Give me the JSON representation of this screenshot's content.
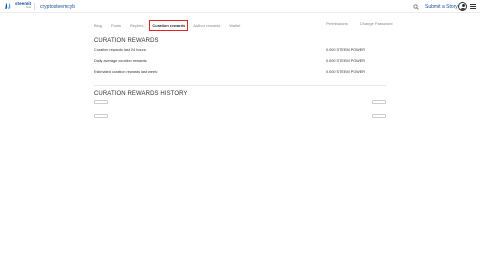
{
  "header": {
    "logo_text": "steemit",
    "logo_sub": "beta",
    "username": "cryptosteemcyb",
    "submit_story": "Submit a Story",
    "icons": {
      "logo": "steemit-logo-icon",
      "search": "search-icon",
      "avatar": "avatar-icon",
      "menu": "hamburger-menu-icon"
    }
  },
  "tabs": {
    "left": [
      "Blog",
      "Posts",
      "Replies",
      "Curation rewards",
      "Author rewards",
      "Wallet"
    ],
    "active": "Curation rewards",
    "right": [
      "Permissions",
      "Change Password"
    ]
  },
  "curation": {
    "title": "CURATION REWARDS",
    "rows": [
      {
        "label": "Curation rewards last 24 hours:",
        "value": "0.000 STEEM POWER"
      },
      {
        "label": "Daily average curation rewards:",
        "value": "0.000 STEEM POWER"
      },
      {
        "label": "Estimated curation rewards last week:",
        "value": "0.000 STEEM POWER"
      }
    ]
  },
  "history": {
    "title": "CURATION REWARDS HISTORY",
    "prev_label": "",
    "next_label": ""
  },
  "colors": {
    "accent": "#1a5099",
    "active_tab_border": "#e02424"
  }
}
